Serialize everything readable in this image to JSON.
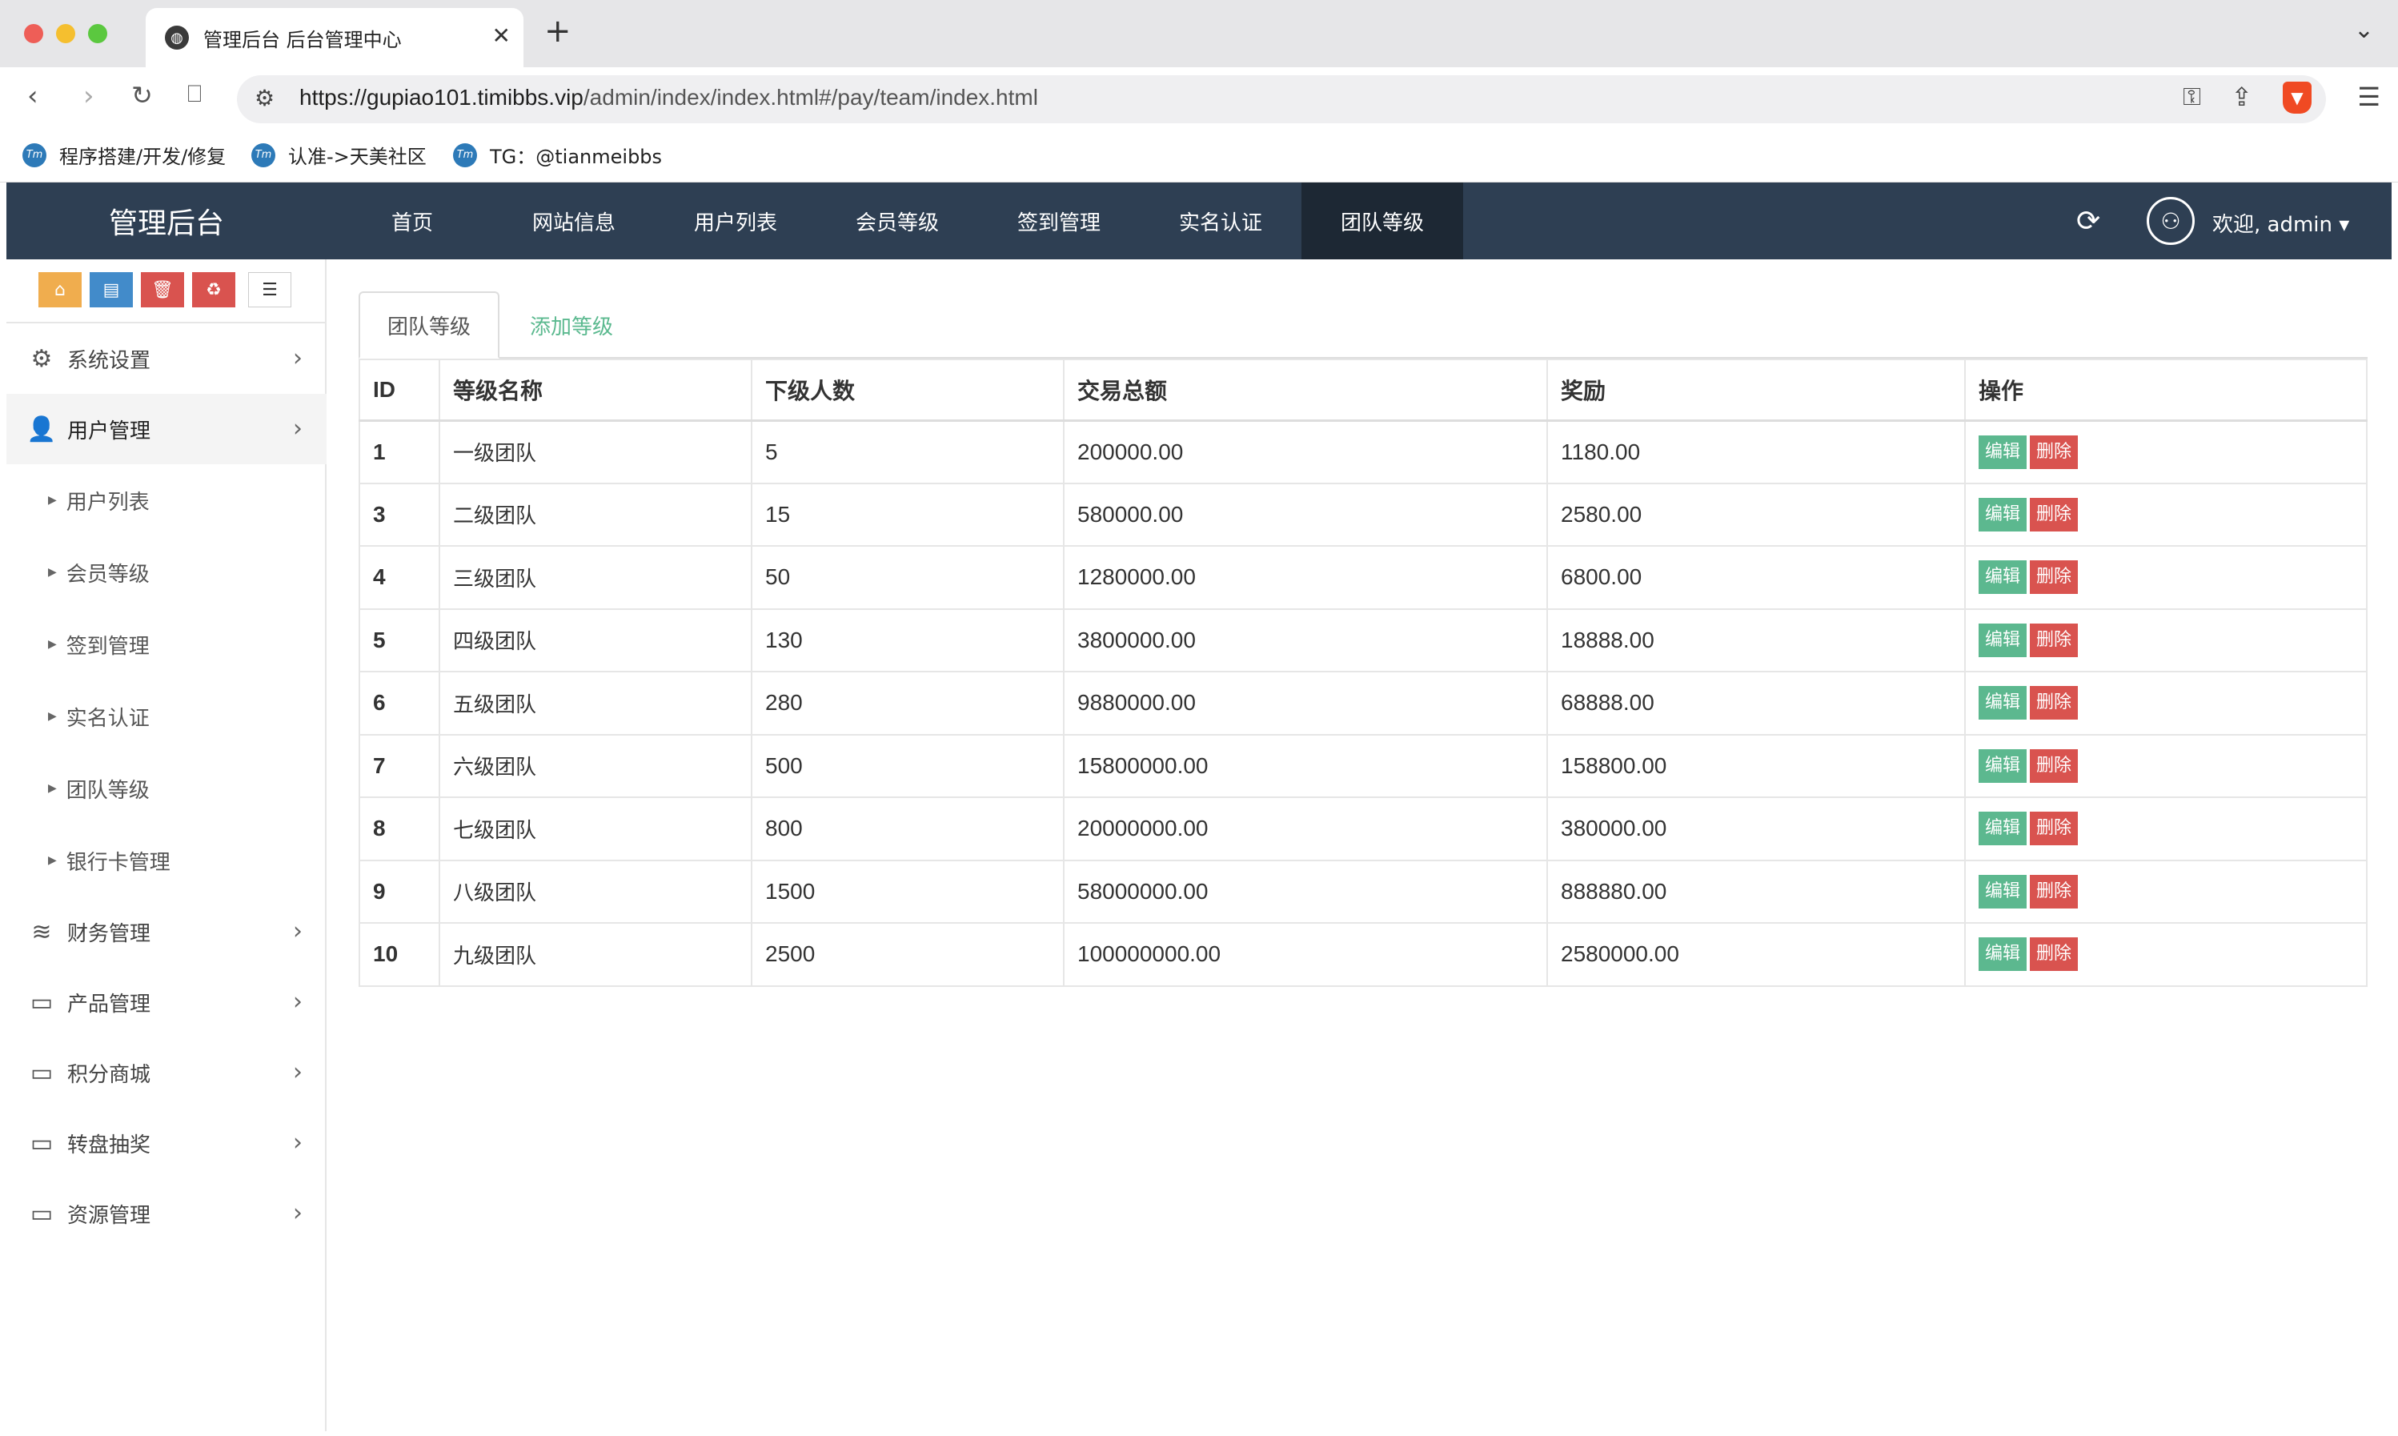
{
  "browser": {
    "tab_title": "管理后台 后台管理中心",
    "url_host": "https://gupiao101.timibbs.vip",
    "url_path": "/admin/index/index.html#/pay/team/index.html",
    "bookmarks": [
      "程序搭建/开发/修复",
      "认准->天美社区",
      "TG：@tianmeibbs"
    ]
  },
  "header": {
    "brand": "管理后台",
    "nav": [
      "首页",
      "网站信息",
      "用户列表",
      "会员等级",
      "签到管理",
      "实名认证",
      "团队等级"
    ],
    "active_nav": "团队等级",
    "welcome": "欢迎, admin"
  },
  "sidebar": {
    "menu": [
      {
        "label": "系统设置",
        "icon": "gears-icon"
      },
      {
        "label": "用户管理",
        "icon": "user-icon",
        "active": true
      },
      {
        "label": "财务管理",
        "icon": "database-icon"
      },
      {
        "label": "产品管理",
        "icon": "monitor-icon"
      },
      {
        "label": "积分商城",
        "icon": "monitor-icon"
      },
      {
        "label": "转盘抽奖",
        "icon": "monitor-icon"
      },
      {
        "label": "资源管理",
        "icon": "monitor-icon"
      }
    ],
    "submenu": [
      "用户列表",
      "会员等级",
      "签到管理",
      "实名认证",
      "团队等级",
      "银行卡管理"
    ]
  },
  "content": {
    "tabs": [
      "团队等级",
      "添加等级"
    ],
    "columns": [
      "ID",
      "等级名称",
      "下级人数",
      "交易总额",
      "奖励",
      "操作"
    ],
    "rows": [
      {
        "id": "1",
        "name": "一级团队",
        "count": "5",
        "total": "200000.00",
        "reward": "1180.00"
      },
      {
        "id": "3",
        "name": "二级团队",
        "count": "15",
        "total": "580000.00",
        "reward": "2580.00"
      },
      {
        "id": "4",
        "name": "三级团队",
        "count": "50",
        "total": "1280000.00",
        "reward": "6800.00"
      },
      {
        "id": "5",
        "name": "四级团队",
        "count": "130",
        "total": "3800000.00",
        "reward": "18888.00"
      },
      {
        "id": "6",
        "name": "五级团队",
        "count": "280",
        "total": "9880000.00",
        "reward": "68888.00"
      },
      {
        "id": "7",
        "name": "六级团队",
        "count": "500",
        "total": "15800000.00",
        "reward": "158800.00"
      },
      {
        "id": "8",
        "name": "七级团队",
        "count": "800",
        "total": "20000000.00",
        "reward": "380000.00"
      },
      {
        "id": "9",
        "name": "八级团队",
        "count": "1500",
        "total": "58000000.00",
        "reward": "888880.00"
      },
      {
        "id": "10",
        "name": "九级团队",
        "count": "2500",
        "total": "100000000.00",
        "reward": "2580000.00"
      }
    ],
    "edit_label": "编辑",
    "delete_label": "删除"
  }
}
